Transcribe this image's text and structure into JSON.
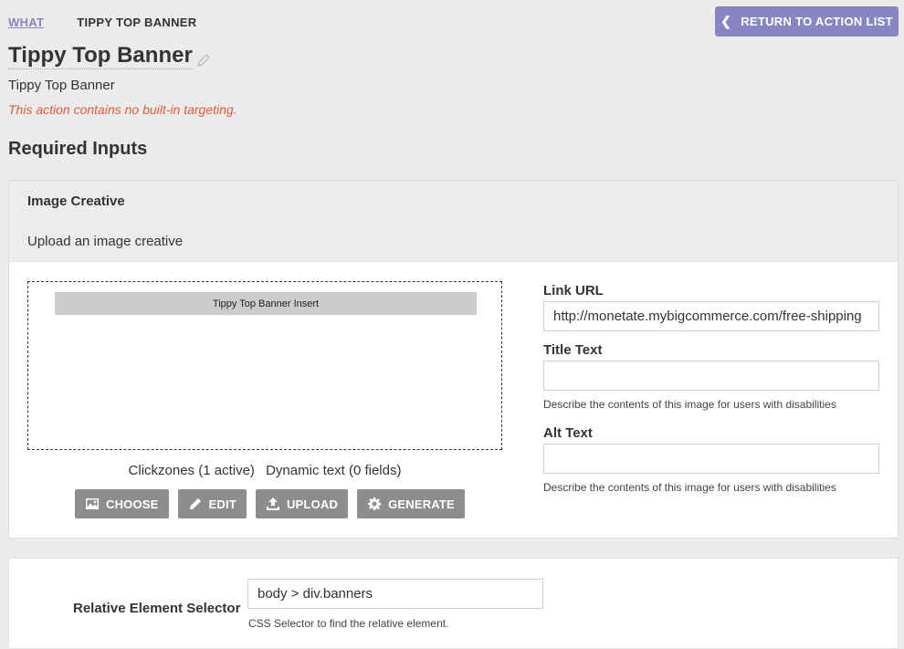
{
  "breadcrumb": {
    "link": "WHAT",
    "current": "TIPPY TOP BANNER"
  },
  "return_button": {
    "label": "RETURN TO ACTION LIST",
    "icon": "chevron-left-icon"
  },
  "header": {
    "title": "Tippy Top Banner",
    "subtitle": "Tippy Top Banner",
    "warning": "This action contains no built-in targeting."
  },
  "section_heading": "Required Inputs",
  "image_creative": {
    "title": "Image Creative",
    "description": "Upload an image creative",
    "banner_text": "Tippy Top Banner Insert",
    "clickzones": "Clickzones (1 active)",
    "dynamic_text": "Dynamic text (0 fields)",
    "buttons": {
      "choose": "CHOOSE",
      "edit": "EDIT",
      "upload": "UPLOAD",
      "generate": "GENERATE"
    }
  },
  "fields": {
    "link_url": {
      "label": "Link URL",
      "value": "http://monetate.mybigcommerce.com/free-shipping"
    },
    "title_text": {
      "label": "Title Text",
      "value": "",
      "help": "Describe the contents of this image for users with disabilities"
    },
    "alt_text": {
      "label": "Alt Text",
      "value": "",
      "help": "Describe the contents of this image for users with disabilities"
    }
  },
  "relative_selector": {
    "label": "Relative Element Selector",
    "value": "body > div.banners",
    "help": "CSS Selector to find the relative element."
  },
  "colors": {
    "accent": "#8a84c4",
    "warning": "#e05a3c",
    "tool_button": "#8d8d8d"
  }
}
